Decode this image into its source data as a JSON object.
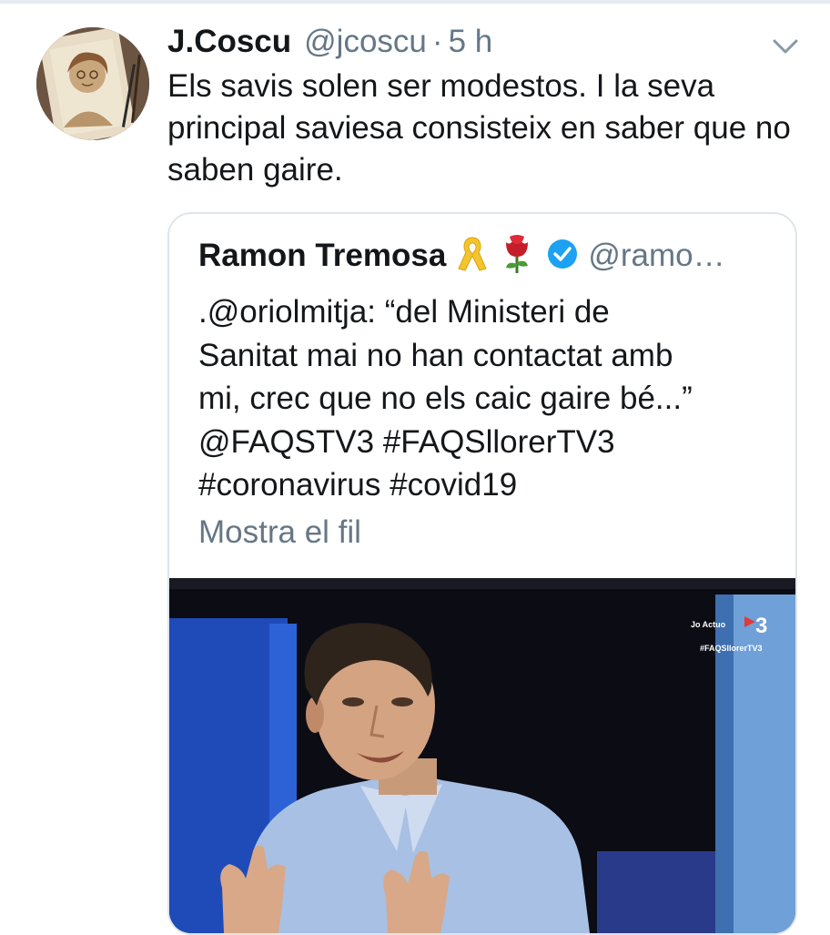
{
  "tweet": {
    "author_name": "J.Coscu",
    "author_handle": "@jcoscu",
    "separator": "·",
    "time": "5 h",
    "text": "Els savis solen ser modestos. I la seva principal saviesa consisteix en saber que no saben gaire."
  },
  "quoted_tweet": {
    "author_name": "Ramon Tremosa",
    "author_handle": "@ramo…",
    "text_lines": [
      ".@oriolmitja:  “del Ministeri de",
      "Sanitat mai no han contactat amb",
      "mi, crec que no els caic gaire bé...”",
      "@FAQSTV3 #FAQSllorerTV3",
      "#coronavirus #covid19"
    ],
    "show_thread_label": "Mostra el fil",
    "media_overlay": {
      "line1": "Jo Actuo",
      "line2": "#FAQSllorerTV3",
      "logo": "3"
    }
  },
  "icons": {
    "chevron": "chevron-down-icon",
    "ribbon": "yellow-ribbon-icon",
    "rose": "rose-icon",
    "verified": "verified-badge-icon"
  },
  "colors": {
    "text_primary": "#14171a",
    "text_secondary": "#657786",
    "verified_blue": "#1da1f2",
    "card_border": "#dfe5ea"
  }
}
